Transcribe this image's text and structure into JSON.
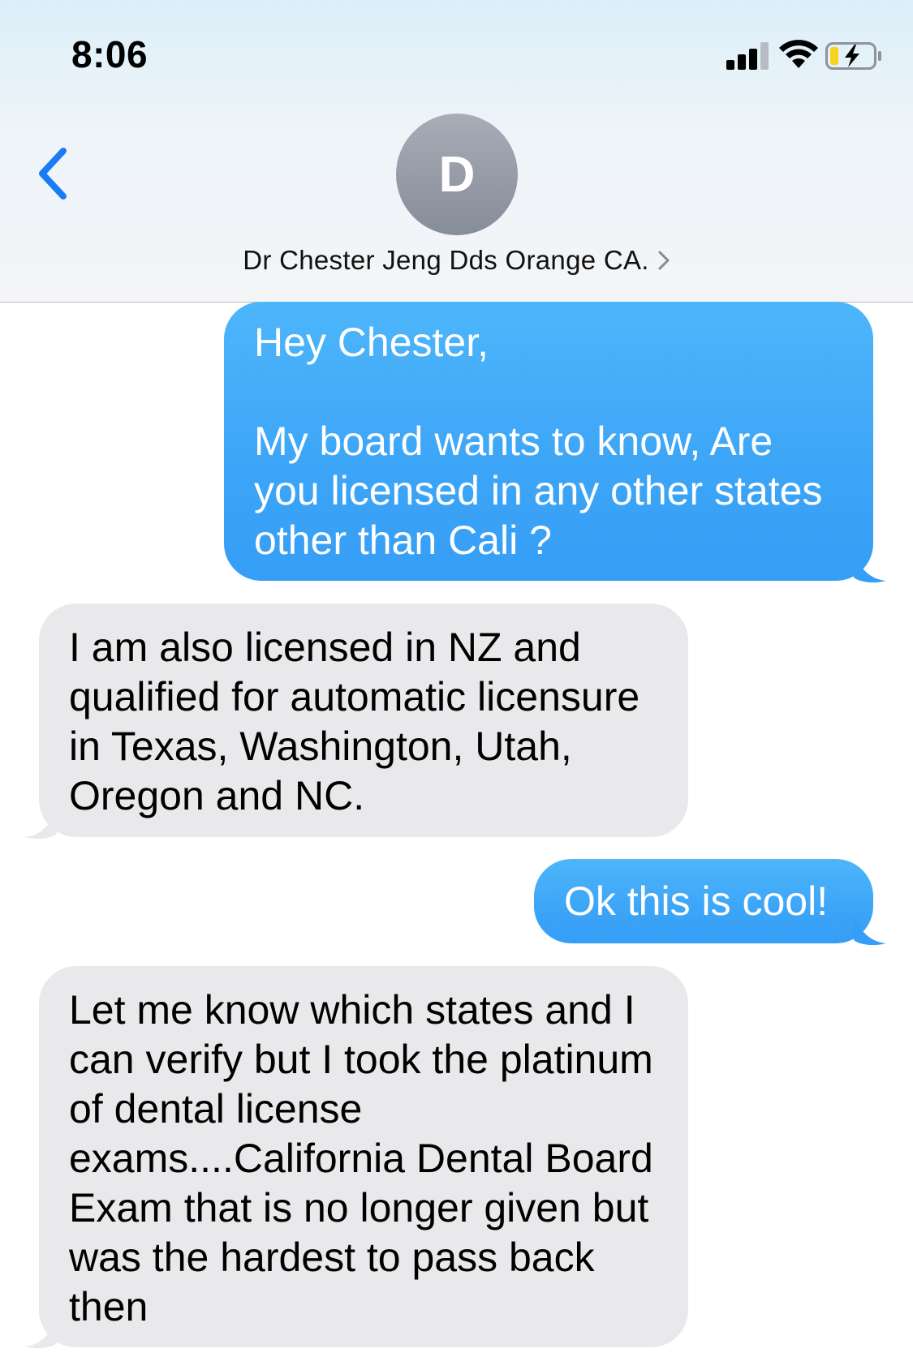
{
  "status_bar": {
    "time": "8:06",
    "signal_icon": "cellular-signal-icon",
    "wifi_icon": "wifi-icon",
    "battery_icon": "battery-charging-icon",
    "battery_fill_color": "#f7d31b"
  },
  "header": {
    "back_icon": "chevron-left-icon",
    "avatar_initial": "D",
    "contact_name": "Dr Chester Jeng Dds Orange CA.",
    "contact_chevron_icon": "chevron-right-icon"
  },
  "colors": {
    "sent_bubble": "#3ea6f7",
    "received_bubble": "#e9e9eb",
    "accent": "#1a7cf5"
  },
  "messages": [
    {
      "direction": "sent",
      "text": "Hey Chester,\n\nMy board wants to know, Are you licensed in any other states other than Cali ?"
    },
    {
      "direction": "received",
      "text": "I am also licensed in NZ and qualified for automatic licensure in Texas, Washington, Utah, Oregon and NC."
    },
    {
      "direction": "sent",
      "text": "Ok this is cool!"
    },
    {
      "direction": "received",
      "text": "Let me know which states and I can verify but I took the platinum of dental license exams....California Dental Board Exam that is no longer given but was the hardest to pass back then"
    }
  ]
}
